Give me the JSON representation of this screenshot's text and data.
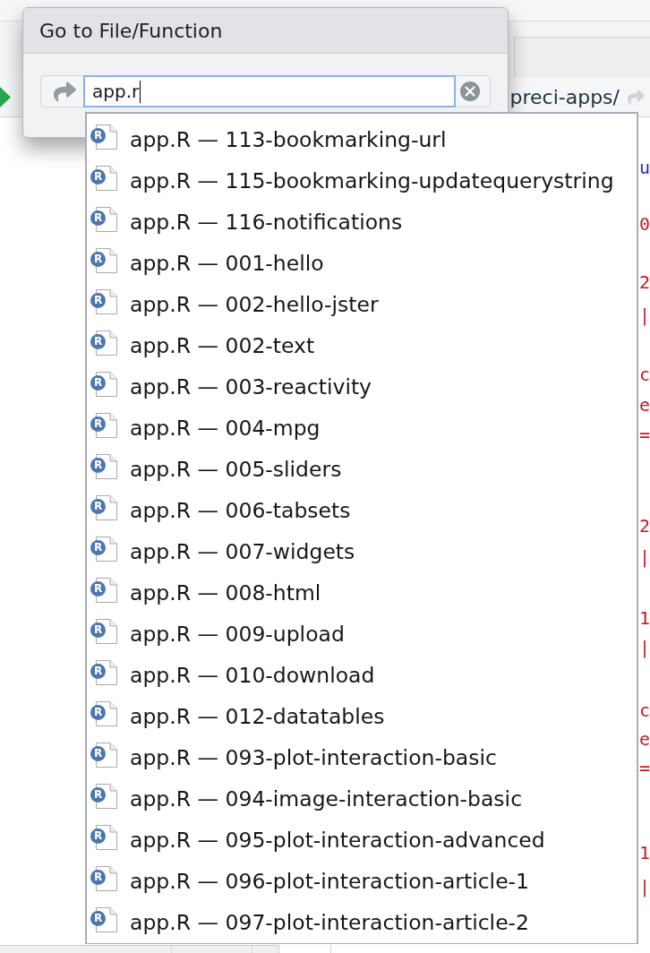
{
  "toolbar": {
    "path": "preci-apps/"
  },
  "editor": {
    "code_fragments": [
      {
        "text": "u",
        "kind": "keyword"
      },
      {
        "text": "0",
        "kind": "string"
      },
      {
        "text": "2",
        "kind": "string"
      },
      {
        "text": "|",
        "kind": "string"
      },
      {
        "text": "c",
        "kind": "string"
      },
      {
        "text": "e",
        "kind": "string"
      },
      {
        "text": "=",
        "kind": "string"
      },
      {
        "text": "2",
        "kind": "string"
      },
      {
        "text": "|",
        "kind": "string"
      },
      {
        "text": "1",
        "kind": "string"
      },
      {
        "text": "|",
        "kind": "string"
      },
      {
        "text": "c",
        "kind": "string"
      },
      {
        "text": "e",
        "kind": "string"
      },
      {
        "text": "=",
        "kind": "string"
      },
      {
        "text": "1",
        "kind": "string"
      },
      {
        "text": "|",
        "kind": "string"
      }
    ]
  },
  "dialog": {
    "title": "Go to File/Function",
    "search": {
      "value": "app.r",
      "focused": true
    }
  },
  "results": [
    {
      "badge": "R",
      "label": "app.R — 113-bookmarking-url",
      "selected": false
    },
    {
      "badge": "R",
      "label": "app.R — 115-bookmarking-updatequerystring",
      "selected": false
    },
    {
      "badge": "R",
      "label": "app.R — 116-notifications",
      "selected": false
    },
    {
      "badge": "R",
      "label": "app.R — 001-hello",
      "selected": false
    },
    {
      "badge": "R",
      "label": "app.R — 002-hello-jster",
      "selected": false
    },
    {
      "badge": "R",
      "label": "app.R — 002-text",
      "selected": false
    },
    {
      "badge": "R",
      "label": "app.R — 003-reactivity",
      "selected": false
    },
    {
      "badge": "R",
      "label": "app.R — 004-mpg",
      "selected": false
    },
    {
      "badge": "R",
      "label": "app.R — 005-sliders",
      "selected": false
    },
    {
      "badge": "R",
      "label": "app.R — 006-tabsets",
      "selected": false
    },
    {
      "badge": "R",
      "label": "app.R — 007-widgets",
      "selected": false
    },
    {
      "badge": "R",
      "label": "app.R — 008-html",
      "selected": false
    },
    {
      "badge": "R",
      "label": "app.R — 009-upload",
      "selected": false
    },
    {
      "badge": "R",
      "label": "app.R — 010-download",
      "selected": false
    },
    {
      "badge": "R",
      "label": "app.R — 012-datatables",
      "selected": false
    },
    {
      "badge": "R",
      "label": "app.R — 093-plot-interaction-basic",
      "selected": false
    },
    {
      "badge": "R",
      "label": "app.R — 094-image-interaction-basic",
      "selected": false
    },
    {
      "badge": "R",
      "label": "app.R — 095-plot-interaction-advanced",
      "selected": false
    },
    {
      "badge": "R",
      "label": "app.R — 096-plot-interaction-article-1",
      "selected": false
    },
    {
      "badge": "R",
      "label": "app.R — 097-plot-interaction-article-2",
      "selected": false
    }
  ]
}
